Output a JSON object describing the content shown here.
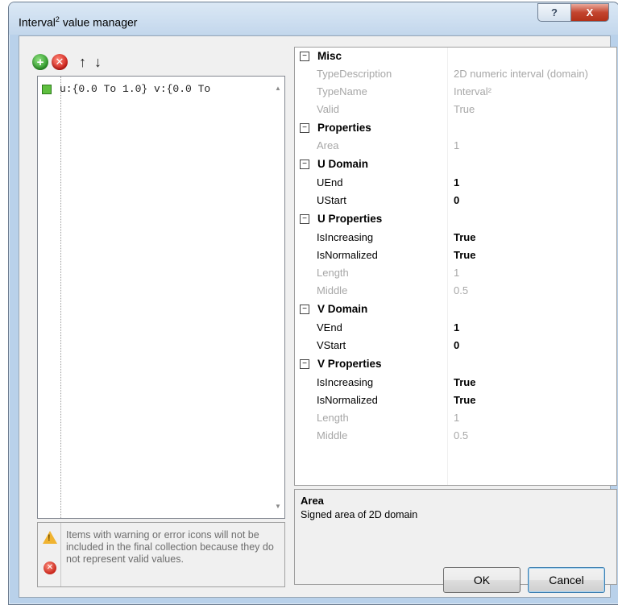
{
  "window": {
    "title_main": "Interval",
    "title_sup": "2",
    "title_rest": " value manager",
    "help_glyph": "?",
    "close_glyph": "X"
  },
  "toolbar": {
    "add_icon": "add-circle-icon",
    "remove_icon": "remove-circle-icon",
    "move_up_glyph": "↑",
    "move_down_glyph": "↓"
  },
  "list": {
    "items": [
      {
        "text": "u:{0.0 To 1.0} v:{0.0 To"
      }
    ],
    "scroll_up_glyph": "▲",
    "scroll_down_glyph": "▼"
  },
  "warning": {
    "text": "Items with warning or error icons will not be included in the final collection because they do not represent valid values.",
    "warn_glyph": "!",
    "error_glyph": "✕"
  },
  "grid": {
    "collapse_glyph": "−",
    "categories": [
      {
        "label": "Misc"
      },
      {
        "label": "Properties"
      },
      {
        "label": "U Domain"
      },
      {
        "label": "U Properties"
      },
      {
        "label": "V Domain"
      },
      {
        "label": "V Properties"
      }
    ],
    "props": [
      {
        "name": "TypeDescription",
        "value": "2D numeric interval (domain)"
      },
      {
        "name": "TypeName",
        "value": "Interval²"
      },
      {
        "name": "Valid",
        "value": "True"
      },
      {
        "name": "Area",
        "value": "1"
      },
      {
        "name": "UEnd",
        "value": "1"
      },
      {
        "name": "UStart",
        "value": "0"
      },
      {
        "name": "IsIncreasing",
        "value": "True"
      },
      {
        "name": "IsNormalized",
        "value": "True"
      },
      {
        "name": "Length",
        "value": "1"
      },
      {
        "name": "Middle",
        "value": "0.5"
      },
      {
        "name": "VEnd",
        "value": "1"
      },
      {
        "name": "VStart",
        "value": "0"
      },
      {
        "name": "IsIncreasing",
        "value": "True"
      },
      {
        "name": "IsNormalized",
        "value": "True"
      },
      {
        "name": "Length",
        "value": "1"
      },
      {
        "name": "Middle",
        "value": "0.5"
      }
    ]
  },
  "description": {
    "title": "Area",
    "text": "Signed area of 2D domain"
  },
  "buttons": {
    "ok": "OK",
    "cancel": "Cancel"
  }
}
